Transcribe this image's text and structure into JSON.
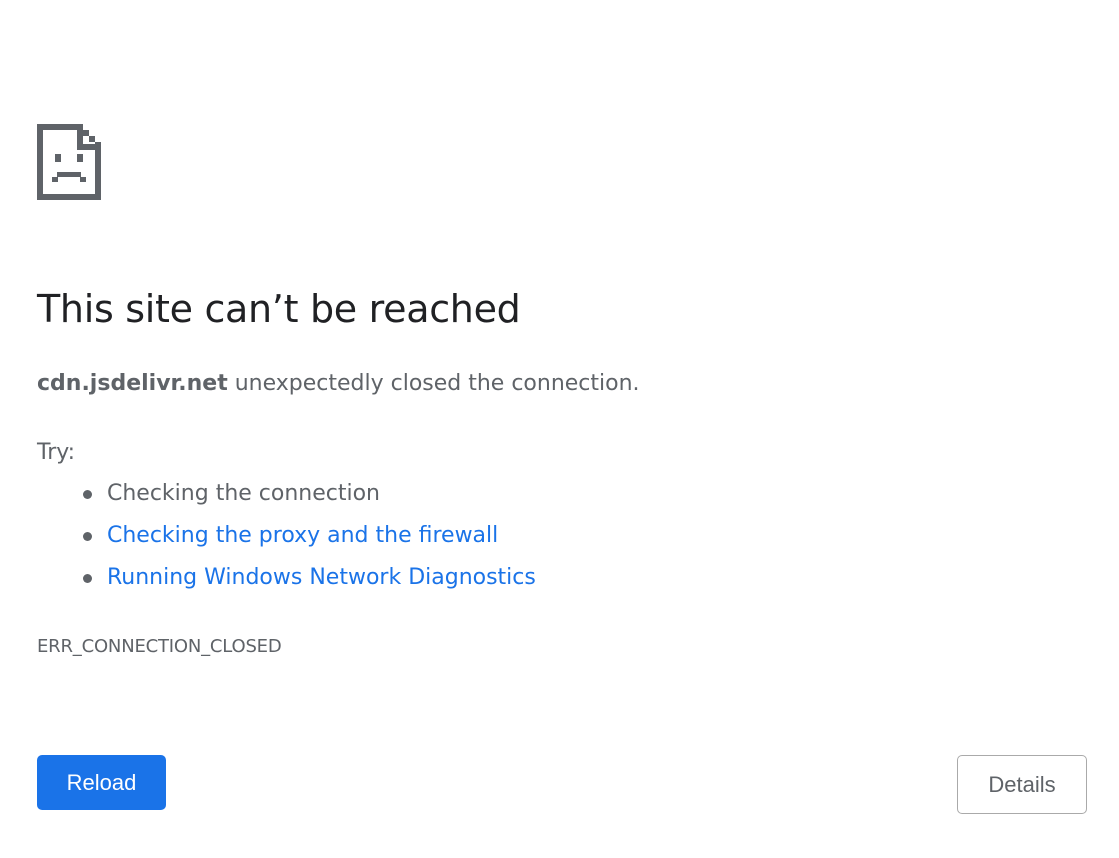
{
  "icon": "sad-page-icon",
  "heading": "This site can’t be reached",
  "summary": {
    "host": "cdn.jsdelivr.net",
    "message": " unexpectedly closed the connection."
  },
  "try_label": "Try:",
  "suggestions": [
    {
      "label": "Checking the connection",
      "is_link": false
    },
    {
      "label": "Checking the proxy and the firewall",
      "is_link": true
    },
    {
      "label": "Running Windows Network Diagnostics",
      "is_link": true
    }
  ],
  "error_code": "ERR_CONNECTION_CLOSED",
  "buttons": {
    "reload": "Reload",
    "details": "Details"
  },
  "colors": {
    "link": "#1a73e8",
    "text": "#5f6368",
    "heading": "#202124",
    "primary_button": "#1a73e8"
  }
}
